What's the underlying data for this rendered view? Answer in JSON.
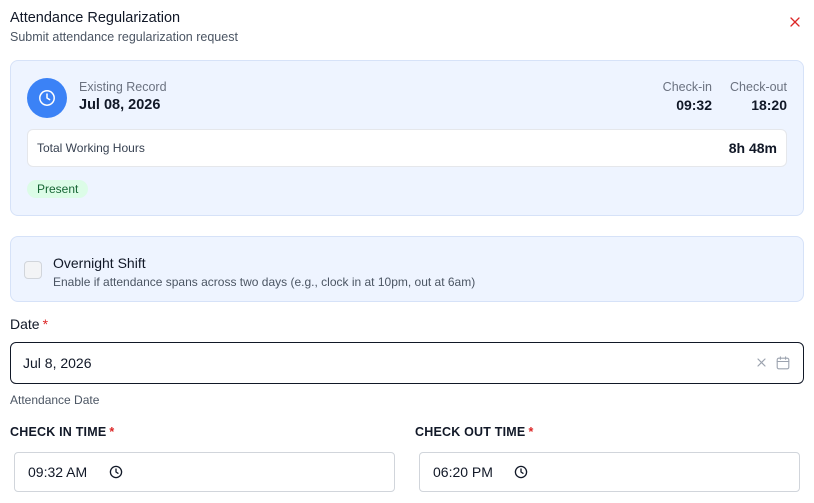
{
  "dialog": {
    "title": "Attendance Regularization",
    "subtitle": "Submit attendance regularization request"
  },
  "record": {
    "label": "Existing Record",
    "date": "Jul 08, 2026",
    "check_in_label": "Check-in",
    "check_in_value": "09:32",
    "check_out_label": "Check-out",
    "check_out_value": "18:20",
    "hours_label": "Total Working Hours",
    "hours_value": "8h 48m",
    "status": "Present"
  },
  "overnight": {
    "title": "Overnight Shift",
    "description": "Enable if attendance spans across two days (e.g., clock in at 10pm, out at 6am)",
    "checked": false
  },
  "date_field": {
    "label": "Date",
    "required_mark": "*",
    "value": "Jul 8, 2026",
    "helper": "Attendance Date"
  },
  "check_in_field": {
    "label": "CHECK IN TIME",
    "required_mark": "*",
    "value": "09:32 AM"
  },
  "check_out_field": {
    "label": "CHECK OUT TIME",
    "required_mark": "*",
    "value": "06:20 PM"
  },
  "colors": {
    "accent": "#3b82f6",
    "card_bg": "#eef4ff",
    "required": "#dc2626",
    "status_bg": "#dcfce7",
    "close": "#dc2626"
  },
  "icons": {
    "close": "close-icon",
    "record": "clock-icon",
    "clear": "clear-icon",
    "calendar": "calendar-icon",
    "time": "clock-icon"
  }
}
